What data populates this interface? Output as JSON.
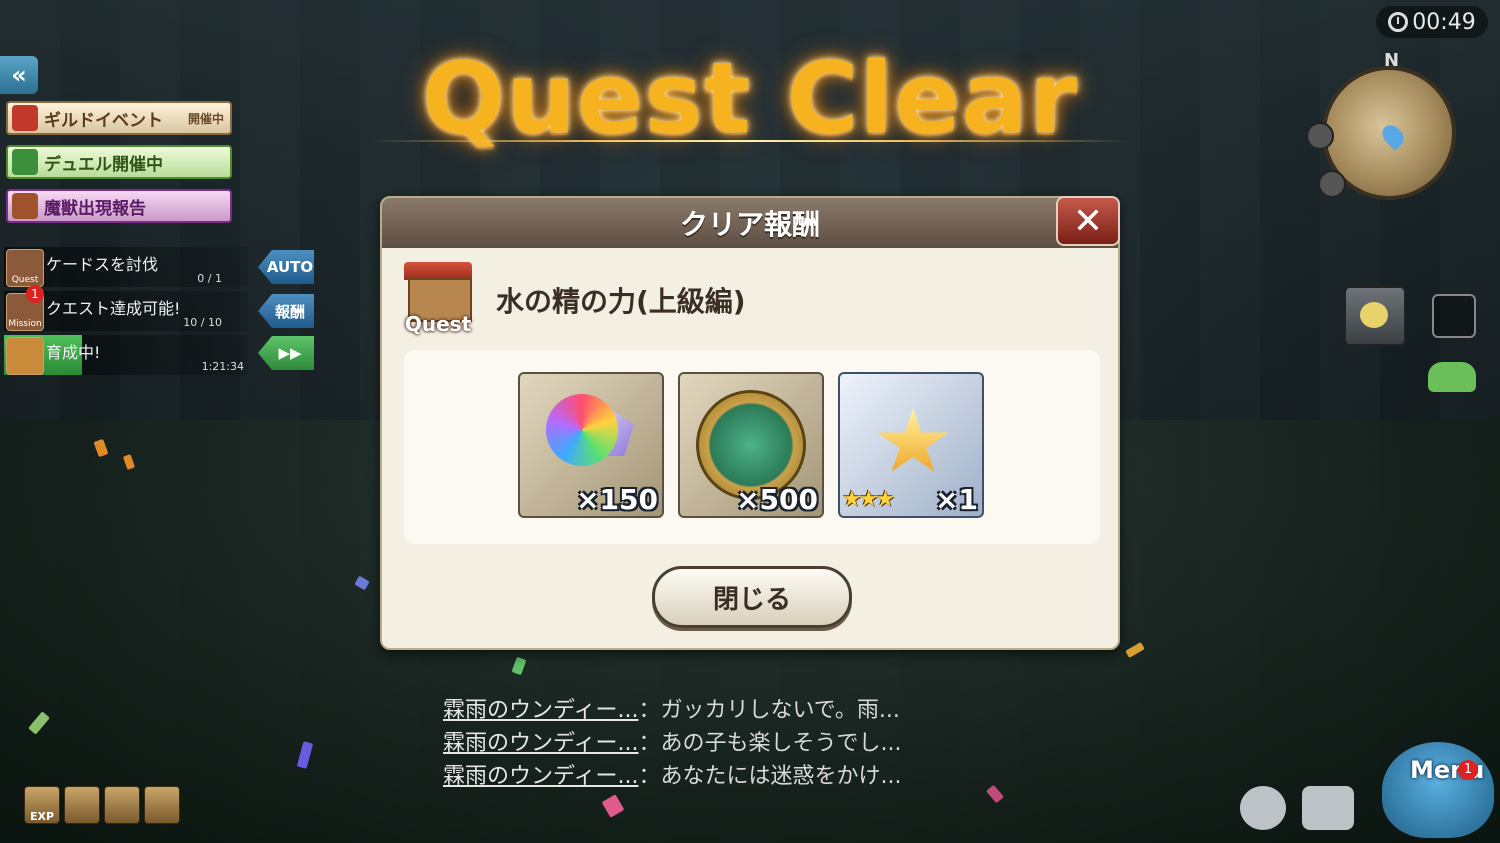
{
  "hud": {
    "timer": "00:49",
    "compass_label": "N"
  },
  "left_panel": {
    "events": [
      {
        "label": "ギルドイベント",
        "tag": "開催中"
      },
      {
        "label": "デュエル開催中"
      },
      {
        "label": "魔獣出現報告"
      }
    ],
    "quests": [
      {
        "icon_label": "Quest",
        "text": "ケードスを討伐",
        "count": "0 / 1",
        "action": "AUTO"
      },
      {
        "icon_label": "Mission",
        "badge": "1",
        "text": "クエスト達成可能!",
        "count": "10 / 10",
        "action": "報酬"
      },
      {
        "text": "育成中!",
        "count": "1:21:34",
        "action_icon": "fast-forward-icon"
      }
    ]
  },
  "title": "Quest Clear",
  "dialog": {
    "header": "クリア報酬",
    "quest_badge_label": "Quest",
    "quest_name": "水の精の力(上級編)",
    "rewards": [
      {
        "item": "rainbow-orb-crystal",
        "quantity": "×150"
      },
      {
        "item": "green-gold-medal",
        "quantity": "×500"
      },
      {
        "item": "gold-star",
        "rarity": "★★★",
        "quantity": "×1"
      }
    ],
    "close_button": "閉じる"
  },
  "chat": [
    {
      "name": "霖雨のウンディー...",
      "message": "：ガッカリしないで。雨..."
    },
    {
      "name": "霖雨のウンディー...",
      "message": "：あの子も楽しそうでし..."
    },
    {
      "name": "霖雨のウンディー...",
      "message": "：あなたには迷惑をかけ..."
    }
  ],
  "bottom": {
    "exp_label": "EXP",
    "menu_label": "Menu",
    "menu_badge": "1"
  }
}
